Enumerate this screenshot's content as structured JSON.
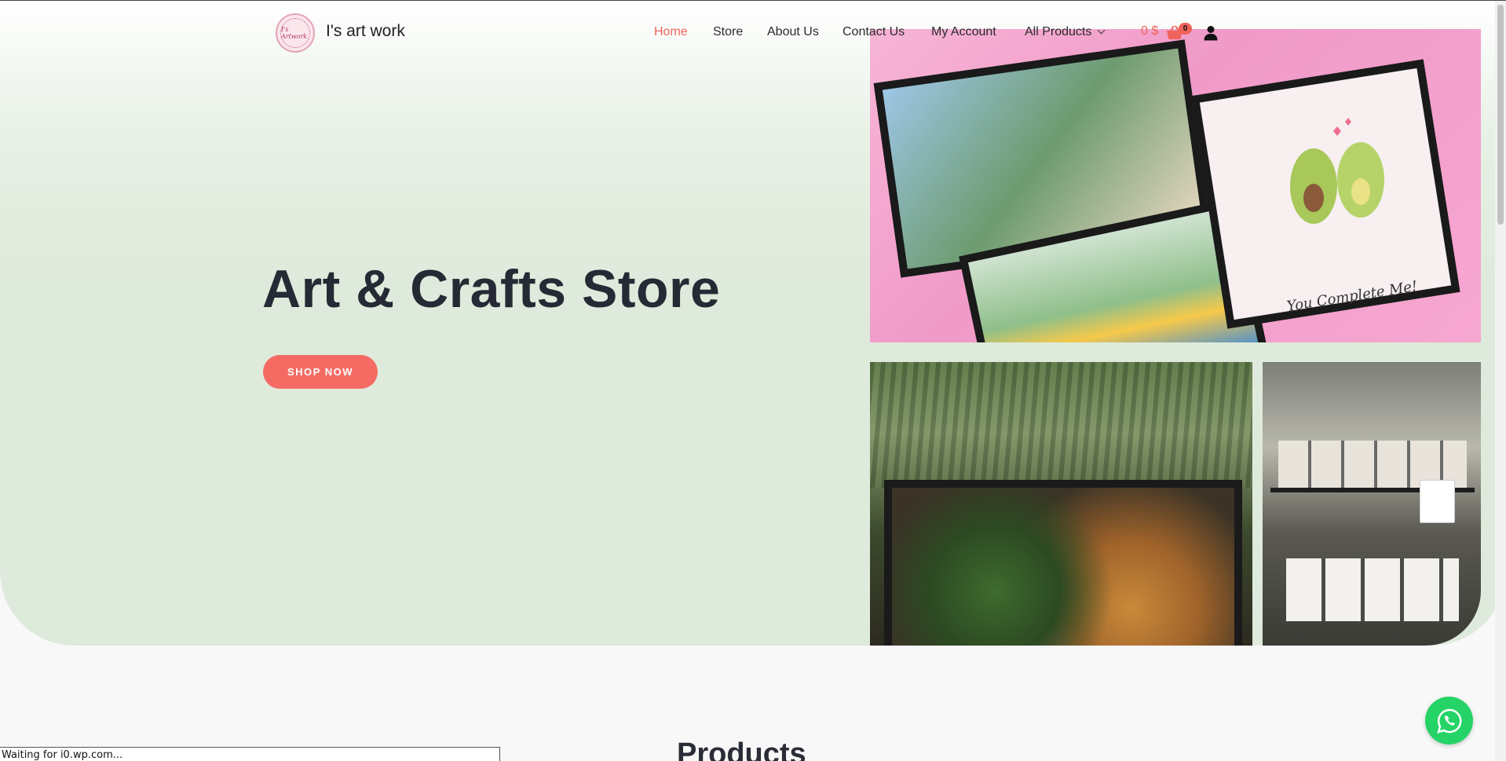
{
  "header": {
    "site_title": "I's art work",
    "logo_text": "I's Artwork"
  },
  "nav": {
    "items": [
      {
        "label": "Home",
        "active": true
      },
      {
        "label": "Store"
      },
      {
        "label": "About Us"
      },
      {
        "label": "Contact Us"
      },
      {
        "label": "My Account"
      },
      {
        "label": "All Products",
        "has_dropdown": true
      }
    ]
  },
  "cart": {
    "price": "0 $",
    "count": "0",
    "icon": "shopping-basket-icon"
  },
  "account": {
    "icon": "user-icon"
  },
  "hero": {
    "title": "Art & Crafts Store",
    "button_label": "SHOP NOW",
    "photo_text": "You Complete Me!"
  },
  "sections": {
    "products_heading": "Products"
  },
  "whatsapp": {
    "icon": "whatsapp-icon"
  },
  "status": {
    "text": "Waiting for i0.wp.com..."
  },
  "colors": {
    "accent": "#f0635a",
    "button": "#f56b64",
    "hero_bg": "#deeadb",
    "whatsapp": "#25d366"
  }
}
